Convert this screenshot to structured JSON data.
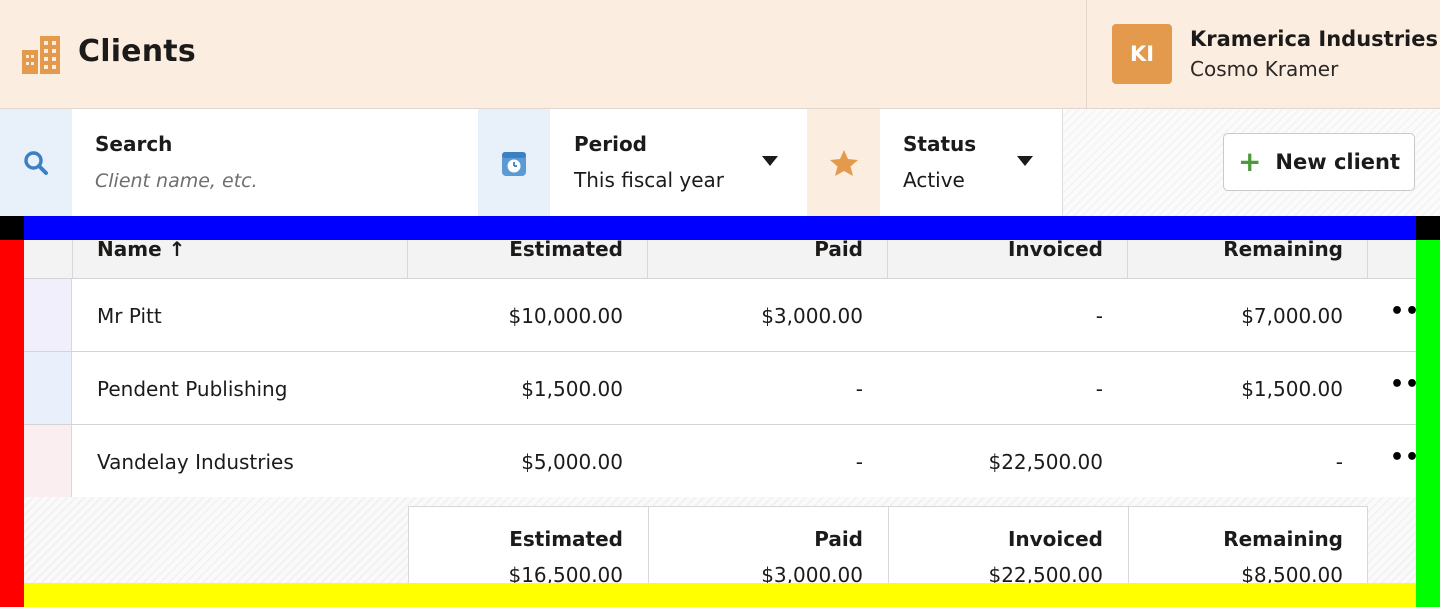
{
  "header": {
    "title": "Clients",
    "title_icon": "building-icon",
    "avatar_initials": "KI",
    "org_name": "Kramerica Industries",
    "user_name": "Cosmo Kramer"
  },
  "filters": {
    "search": {
      "label": "Search",
      "placeholder": "Client name, etc.",
      "icon": "search-icon"
    },
    "period": {
      "label": "Period",
      "value": "This fiscal year",
      "icon": "calendar-clock-icon"
    },
    "status": {
      "label": "Status",
      "value": "Active",
      "icon": "star-icon"
    },
    "new_client_label": "New client"
  },
  "table": {
    "columns": [
      "Name ↑",
      "Estimated",
      "Paid",
      "Invoiced",
      "Remaining"
    ],
    "rows": [
      {
        "name": "Mr Pitt",
        "estimated": "$10,000.00",
        "paid": "$3,000.00",
        "invoiced": "-",
        "remaining": "$7,000.00",
        "color": "#f1effc"
      },
      {
        "name": "Pendent Publishing",
        "estimated": "$1,500.00",
        "paid": "-",
        "invoiced": "-",
        "remaining": "$1,500.00",
        "color": "#eaf0fb"
      },
      {
        "name": "Vandelay Industries",
        "estimated": "$5,000.00",
        "paid": "-",
        "invoiced": "$22,500.00",
        "remaining": "-",
        "color": "#fbeef1"
      }
    ],
    "totals": {
      "labels": [
        "Estimated",
        "Paid",
        "Invoiced",
        "Remaining"
      ],
      "values": [
        "$16,500.00",
        "$3,000.00",
        "$22,500.00",
        "$8,500.00"
      ]
    }
  },
  "colors": {
    "header_bg": "#fcede1",
    "accent_orange": "#e39a4c",
    "plus_green": "#4e9a3a",
    "search_icon_blue": "#3b7fc4"
  }
}
